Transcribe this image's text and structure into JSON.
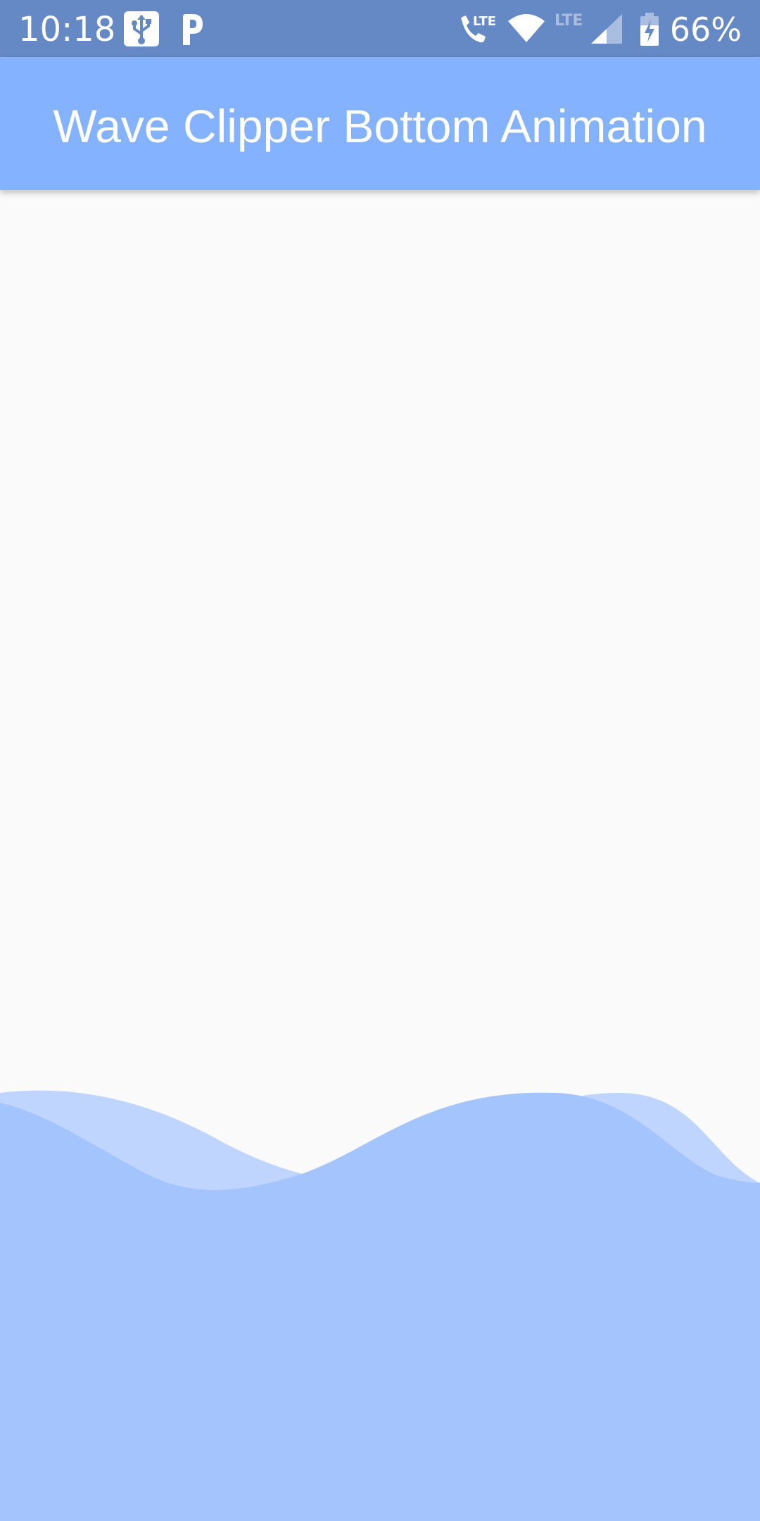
{
  "status_bar": {
    "time": "10:18",
    "battery": "66%",
    "icons": [
      "usb-icon",
      "parking-icon",
      "lte-call-icon",
      "wifi-icon",
      "lte-signal-icon",
      "battery-charging-icon"
    ]
  },
  "app_bar": {
    "title": "Wave Clipper Bottom Animation"
  },
  "colors": {
    "status_bar": "#6589c4",
    "app_bar": "#84b2ff",
    "background": "#fafafa",
    "wave_light": "#bfd5fd",
    "wave_main": "#a3c4fd"
  }
}
